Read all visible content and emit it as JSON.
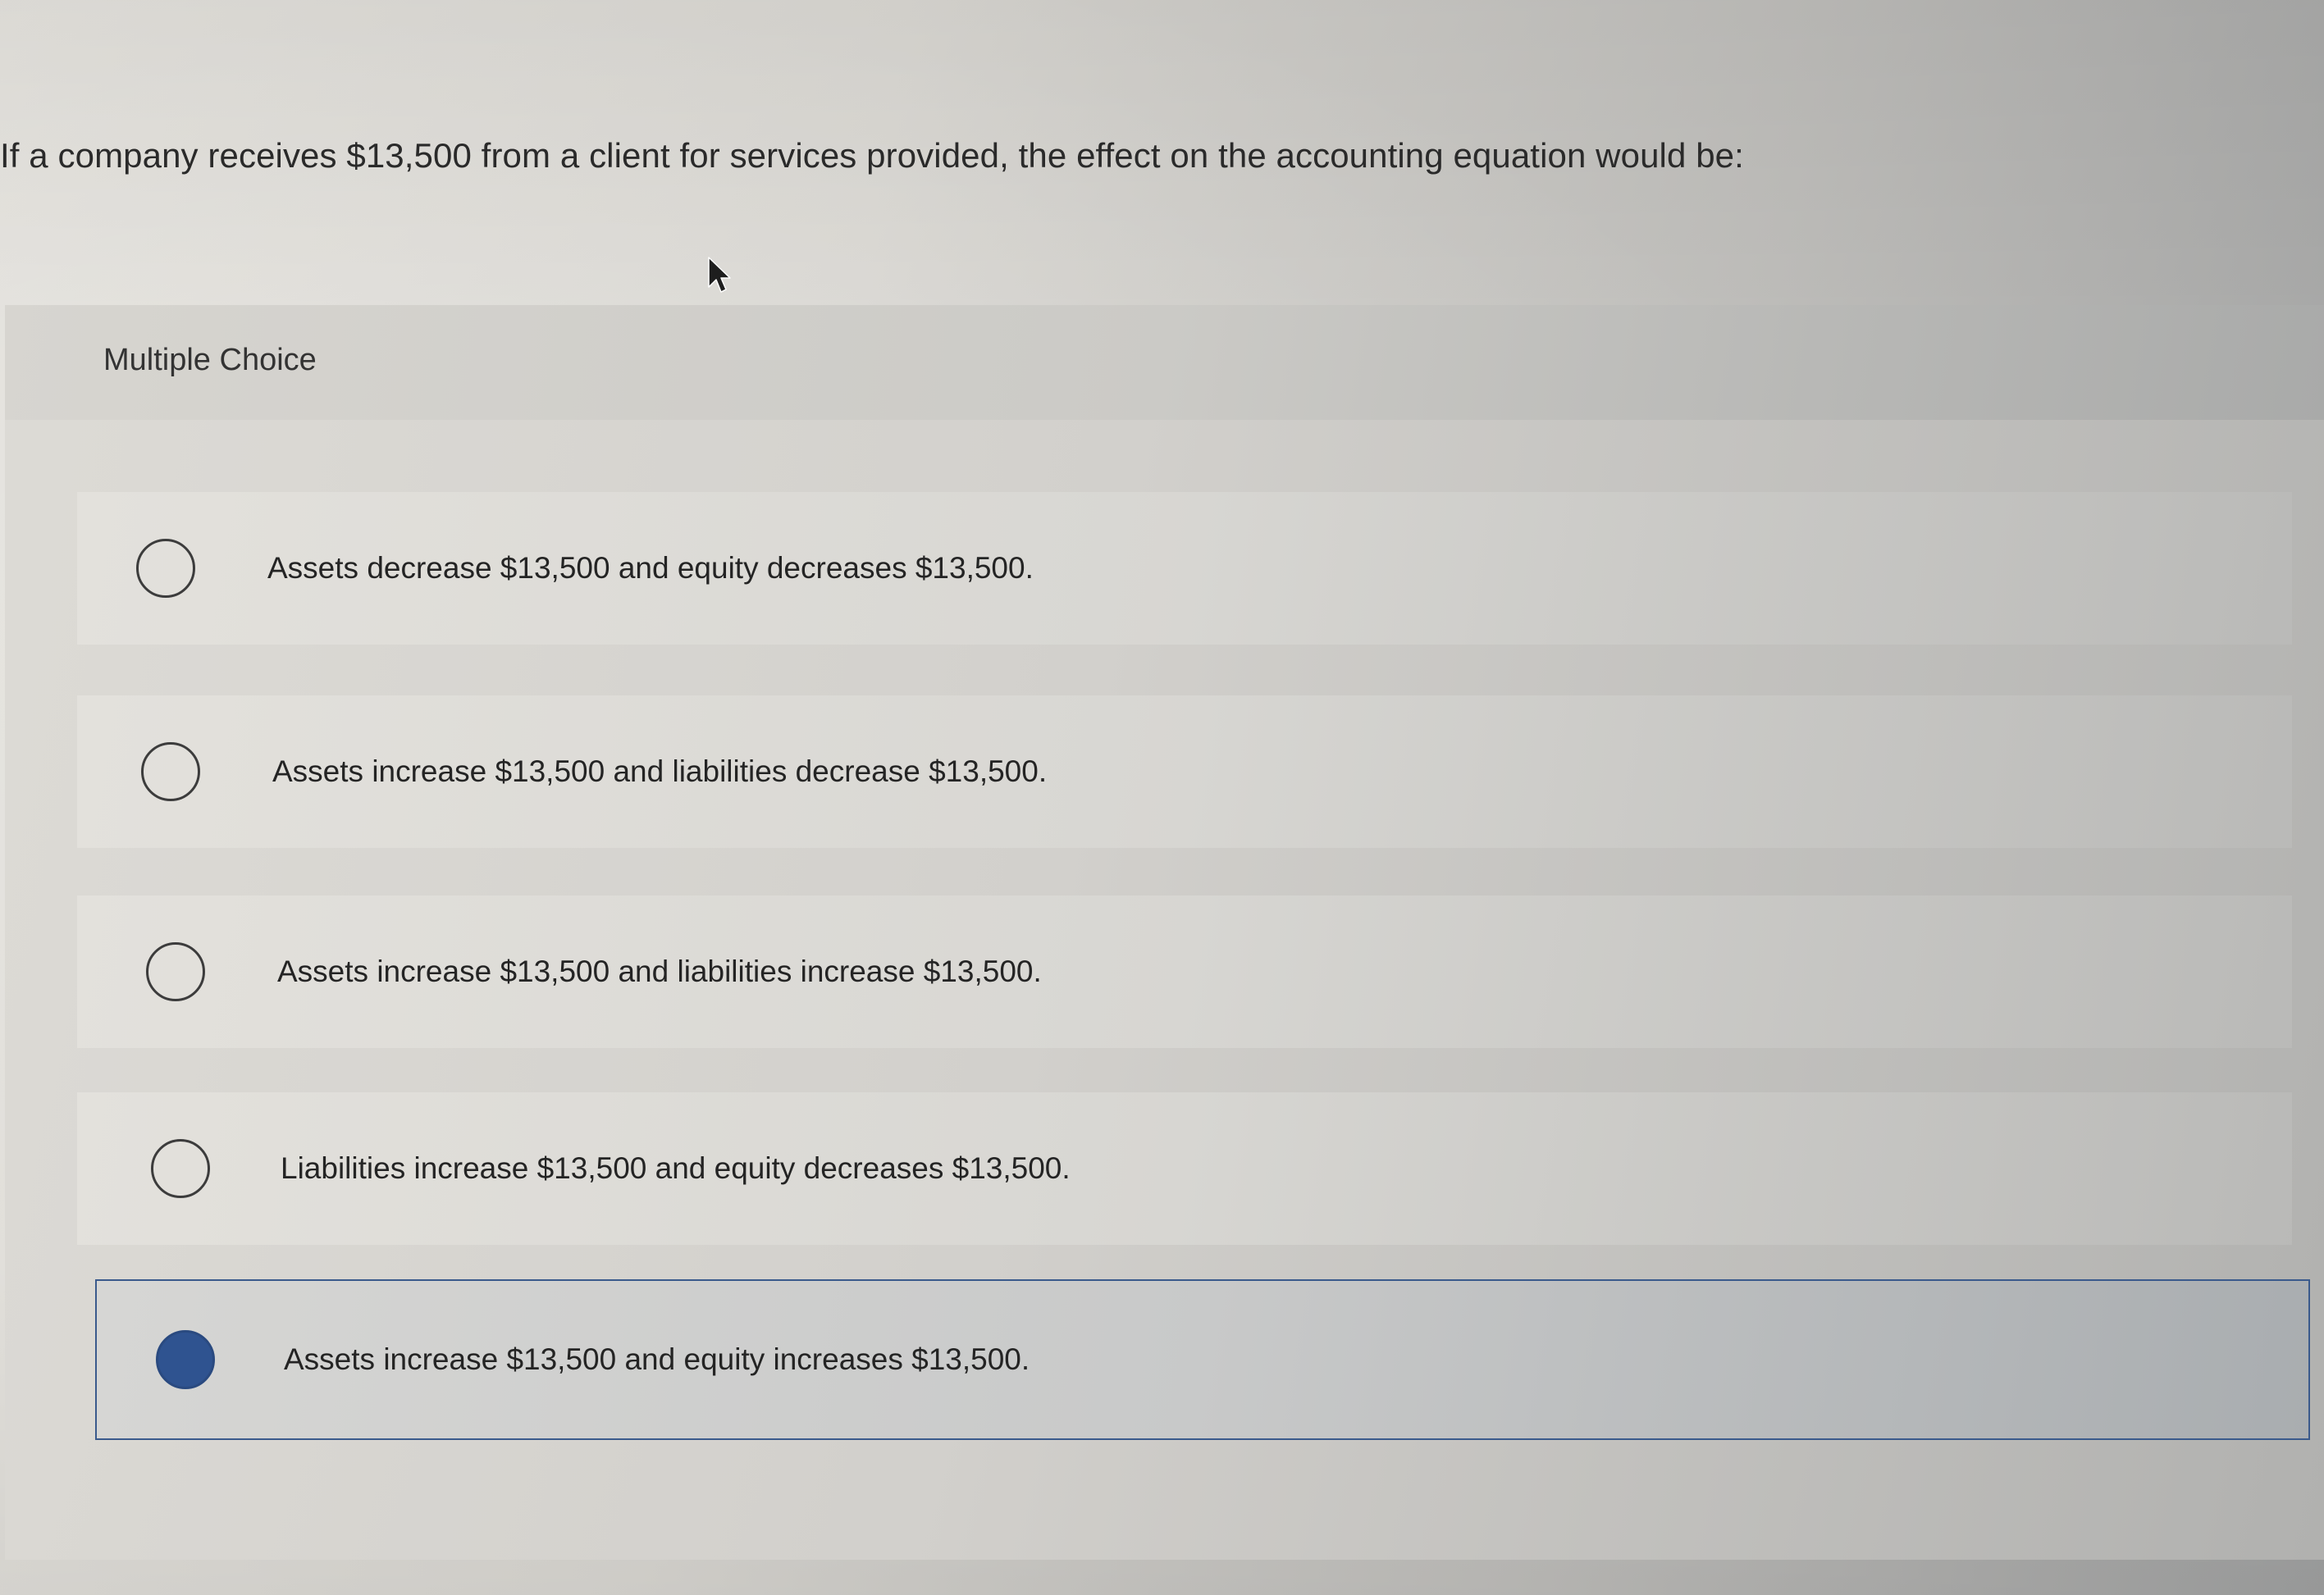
{
  "question": {
    "text": "If a company receives $13,500 from a client for services provided, the effect on the accounting equation would be:"
  },
  "multiple_choice": {
    "label": "Multiple Choice",
    "options": [
      {
        "text": "Assets decrease $13,500 and equity decreases $13,500.",
        "selected": false
      },
      {
        "text": "Assets increase $13,500 and liabilities decrease $13,500.",
        "selected": false
      },
      {
        "text": "Assets increase $13,500 and liabilities increase $13,500.",
        "selected": false
      },
      {
        "text": "Liabilities increase $13,500 and equity decreases $13,500.",
        "selected": false
      },
      {
        "text": "Assets increase $13,500 and equity increases $13,500.",
        "selected": true
      }
    ]
  },
  "colors": {
    "selected_fill": "#2f5390",
    "selected_border": "#3a5a8c"
  },
  "icons": {
    "cursor": "mouse-pointer-icon",
    "radio": "radio-button-icon"
  }
}
